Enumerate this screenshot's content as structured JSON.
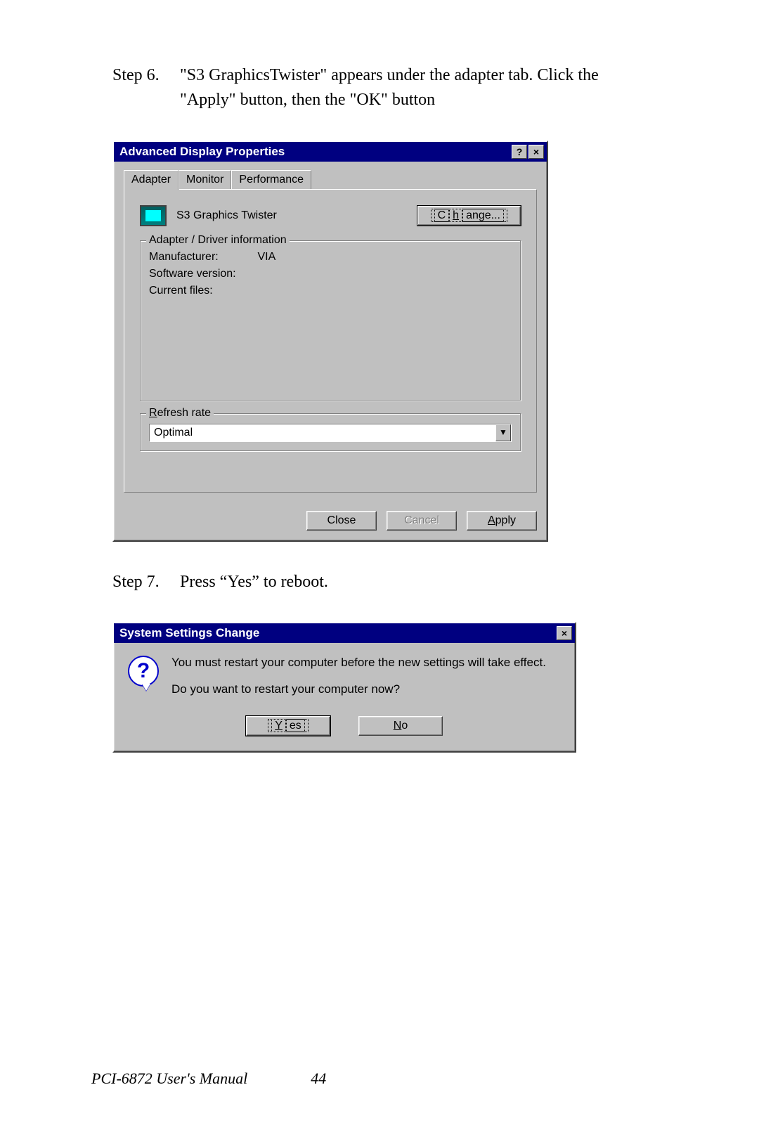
{
  "step6": {
    "label": "Step 6.",
    "text": "\"S3  GraphicsTwister\" appears under the adapter tab. Click the \"Apply\" button, then the \"OK\" button"
  },
  "step7": {
    "label": "Step 7.",
    "text": "Press “Yes” to reboot."
  },
  "dialog1": {
    "title": "Advanced Display Properties",
    "help_btn": "?",
    "close_btn": "×",
    "tabs": {
      "adapter": "Adapter",
      "monitor": "Monitor",
      "performance": "Performance"
    },
    "adapter_name": "S3 Graphics Twister",
    "change_btn_pre": "C",
    "change_btn_u": "h",
    "change_btn_post": "ange...",
    "group1_title": "Adapter / Driver information",
    "manufacturer_label": "Manufacturer:",
    "manufacturer_value": "VIA",
    "software_version_label": "Software version:",
    "software_version_value": "",
    "current_files_label": "Current files:",
    "current_files_value": "",
    "group2_title_u": "R",
    "group2_title_post": "efresh rate",
    "refresh_value": "Optimal",
    "close_btn_label": "Close",
    "cancel_btn_label": "Cancel",
    "apply_btn_u": "A",
    "apply_btn_post": "pply"
  },
  "dialog2": {
    "title": "System Settings Change",
    "close_btn": "×",
    "line1": "You must restart your computer before the new settings will take effect.",
    "line2": "Do you want to restart your computer now?",
    "yes_u": "Y",
    "yes_post": "es",
    "no_u": "N",
    "no_post": "o"
  },
  "footer": {
    "title": "PCI-6872 User's Manual",
    "page": "44"
  }
}
